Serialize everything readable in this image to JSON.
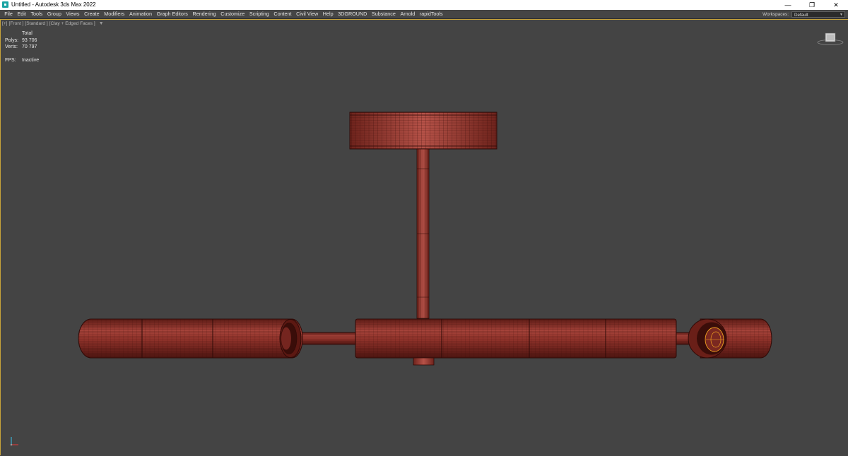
{
  "window": {
    "title": "Untitled - Autodesk 3ds Max 2022",
    "controls": [
      "—",
      "❐",
      "✕"
    ]
  },
  "menu": {
    "items": [
      "File",
      "Edit",
      "Tools",
      "Group",
      "Views",
      "Create",
      "Modifiers",
      "Animation",
      "Graph Editors",
      "Rendering",
      "Customize",
      "Scripting",
      "Content",
      "Civil View",
      "Help",
      "3DGROUND",
      "Substance",
      "Arnold",
      "rapidTools"
    ],
    "workspaces_label": "Workspaces:",
    "workspace_value": "Default"
  },
  "viewport": {
    "labels": [
      "[+]",
      "[Front ]",
      "[Standard ]",
      "[Clay + Edged Faces ]"
    ],
    "stats": {
      "header": "Total",
      "polys_label": "Polys:",
      "polys_value": "93 706",
      "verts_label": "Verts:",
      "verts_value": "70 797",
      "fps_label": "FPS:",
      "fps_value": "Inactive"
    }
  },
  "colors": {
    "viewport_bg": "#444444",
    "mesh_fill": "#8e3129",
    "mesh_wire": "#3d0f0b",
    "active_border": "#c8a33a",
    "selection": "#f0a020"
  },
  "icons": {
    "app": "3ds-max-icon",
    "viewcube": "viewcube-icon",
    "axis": "axis-tripod-icon",
    "filter": "filter-icon"
  }
}
